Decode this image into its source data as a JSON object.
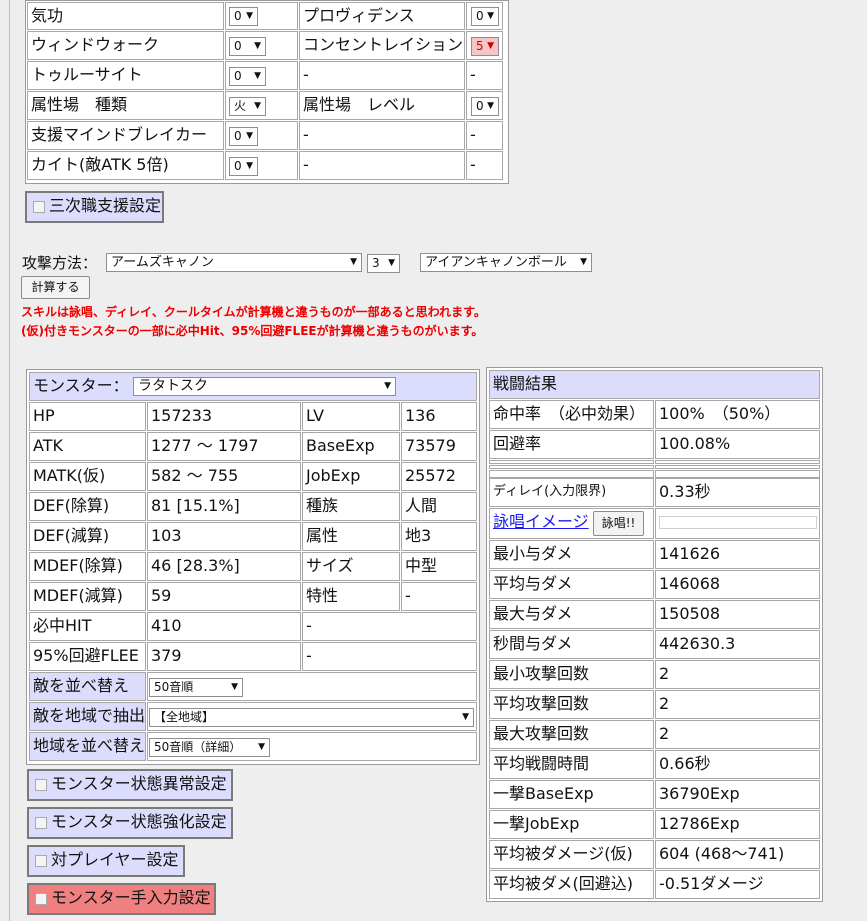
{
  "support_table": {
    "rows": [
      {
        "label": "気功",
        "value": "0",
        "label2": "プロヴィデンス",
        "value2": "0"
      },
      {
        "label": "ウィンドウォーク",
        "value": "0",
        "label2": "コンセントレイション",
        "value2": "5"
      },
      {
        "label": "トゥルーサイト",
        "value": "0",
        "label2": "-",
        "value2": "-"
      },
      {
        "label": "属性場　種類",
        "value": "火",
        "label2": "属性場　レベル",
        "value2": "0"
      },
      {
        "label": "支援マインドブレイカー",
        "value": "0",
        "label2": "-",
        "value2": "-"
      },
      {
        "label": "カイト(敵ATK 5倍)",
        "value": "0",
        "label2": "-",
        "value2": "-"
      }
    ],
    "third_job_toggle": "三次職支援設定"
  },
  "attack": {
    "label": "攻撃方法：",
    "skill": "アームズキャノン",
    "level": "3",
    "ammo": "アイアンキャノンボール",
    "calc_button": "計算する",
    "note1": "スキルは詠唱、ディレイ、クールタイムが計算機と違うものが一部あると思われます。",
    "note2": "(仮)付きモンスターの一部に必中Hit、95%回避FLEEが計算機と違うものがいます。"
  },
  "monster": {
    "label": "モンスター：",
    "selected": "ラタトスク",
    "stats": [
      {
        "k": "HP",
        "v": "157233",
        "k2": "LV",
        "v2": "136"
      },
      {
        "k": "ATK",
        "v": "1277 ～ 1797",
        "k2": "BaseExp",
        "v2": "73579"
      },
      {
        "k": "MATK(仮)",
        "v": "582 ～ 755",
        "k2": "JobExp",
        "v2": "25572"
      },
      {
        "k": "DEF(除算)",
        "v": "81 [15.1%]",
        "k2": "種族",
        "v2": "人間"
      },
      {
        "k": "DEF(減算)",
        "v": "103",
        "k2": "属性",
        "v2": "地3"
      },
      {
        "k": "MDEF(除算)",
        "v": "46 [28.3%]",
        "k2": "サイズ",
        "v2": "中型"
      },
      {
        "k": "MDEF(減算)",
        "v": "59",
        "k2": "特性",
        "v2": "-"
      },
      {
        "k": "必中HIT",
        "v": "410",
        "k2": "-",
        "v2": ""
      },
      {
        "k": "95%回避FLEE",
        "v": "379",
        "k2": "-",
        "v2": ""
      }
    ],
    "sort_label": "敵を並べ替え",
    "sort_value": "50音順",
    "region_label": "敵を地域で抽出",
    "region_value": "【全地域】",
    "region_sort_label": "地域を並べ替え",
    "region_sort_value": "50音順（詳細）",
    "toggles": [
      "モンスター状態異常設定",
      "モンスター状態強化設定",
      "対プレイヤー設定",
      "モンスター手入力設定"
    ]
  },
  "result": {
    "title": "戦闘結果",
    "hit_label": "命中率　（必中効果）",
    "hit_value": "100%　（50%）",
    "flee_label": "回避率",
    "flee_value": "100.08%",
    "delay_label": "ディレイ(入力限界)",
    "delay_value": "0.33秒",
    "cast_link": "詠唱イメージ",
    "cast_button": "詠唱!!",
    "cast_progress": 0,
    "rows": [
      {
        "k": "最小与ダメ",
        "v": "141626"
      },
      {
        "k": "平均与ダメ",
        "v": "146068"
      },
      {
        "k": "最大与ダメ",
        "v": "150508"
      },
      {
        "k": "秒間与ダメ",
        "v": "442630.3"
      },
      {
        "k": "最小攻撃回数",
        "v": "2"
      },
      {
        "k": "平均攻撃回数",
        "v": "2"
      },
      {
        "k": "最大攻撃回数",
        "v": "2"
      },
      {
        "k": "平均戦闘時間",
        "v": "0.66秒"
      },
      {
        "k": "一撃BaseExp",
        "v": "36790Exp"
      },
      {
        "k": "一撃JobExp",
        "v": "12786Exp"
      },
      {
        "k": "平均被ダメージ(仮)",
        "v": "604 (468～741)"
      },
      {
        "k": "平均被ダメ(回避込)",
        "v": "-0.51ダメージ"
      }
    ]
  }
}
